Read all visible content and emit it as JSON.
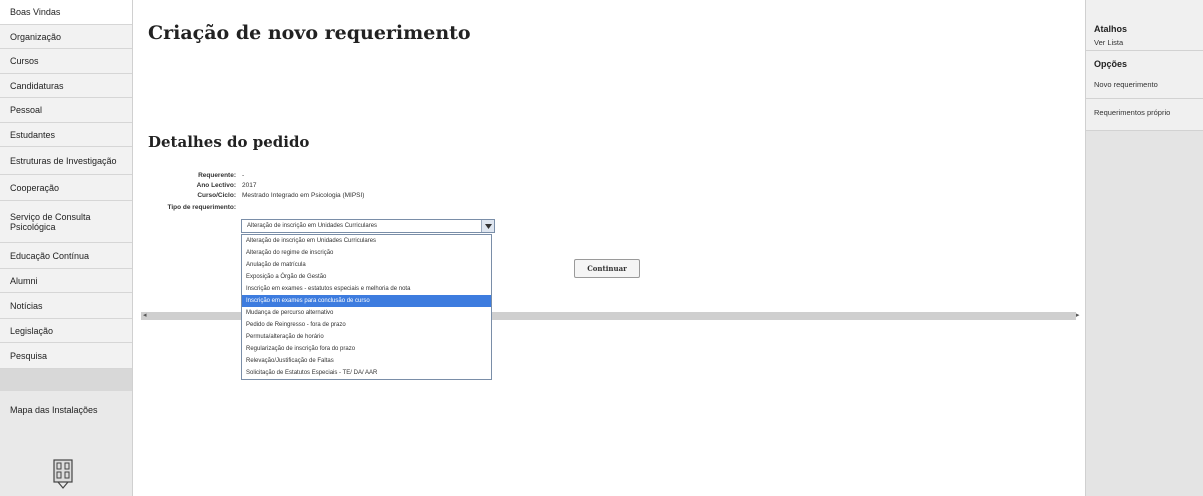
{
  "sidebar": {
    "items": [
      {
        "label": "Boas Vindas"
      },
      {
        "label": "Organização"
      },
      {
        "label": "Cursos"
      },
      {
        "label": "Candidaturas"
      },
      {
        "label": "Pessoal"
      },
      {
        "label": "Estudantes"
      },
      {
        "label": "Estruturas de Investigação"
      },
      {
        "label": "Cooperação"
      },
      {
        "label": "Serviço de Consulta Psicológica"
      },
      {
        "label": "Educação Contínua"
      },
      {
        "label": "Alumni"
      },
      {
        "label": "Notícias"
      },
      {
        "label": "Legislação"
      },
      {
        "label": "Pesquisa"
      }
    ],
    "map_title": "Mapa das Instalações"
  },
  "main": {
    "title": "Criação de novo requerimento",
    "section_title": "Detalhes do pedido",
    "details": [
      {
        "label": "Requerente:",
        "value": "-"
      },
      {
        "label": "Ano Lectivo:",
        "value": "2017"
      },
      {
        "label": "Curso/Ciclo:",
        "value": "Mestrado Integrado em Psicologia (MIPSI)"
      }
    ],
    "type_label": "Tipo de requerimento:",
    "type_selected": "Alteração de inscrição em Unidades Curriculares",
    "options": [
      "Alteração de inscrição em Unidades Curriculares",
      "Alteração do regime de inscrição",
      "Anulação de matrícula",
      "Exposição a Órgão de Gestão",
      "Inscrição em exames - estatutos especiais e melhoria de nota",
      "Inscrição em exames para conclusão de curso",
      "Mudança de percurso alternativo",
      "Pedido de Reingresso - fora de prazo",
      "Permuta/alteração de horário",
      "Regularização de inscrição fora do prazo",
      "Relevação/Justificação de Faltas",
      "Solicitação de Estatutos Especiais - TE/ DA/ AAR"
    ],
    "highlighted_index": 5,
    "continue_label": "Continuar"
  },
  "rightbar": {
    "atalhos_title": "Atalhos",
    "atalhos_links": [
      "Ver Lista"
    ],
    "opcoes_title": "Opções",
    "opcoes_links": [
      "Novo requerimento",
      "Requerimentos próprio"
    ]
  },
  "colors": {
    "highlight": "#3d7cdf",
    "sidebar": "#f2f2f2"
  }
}
